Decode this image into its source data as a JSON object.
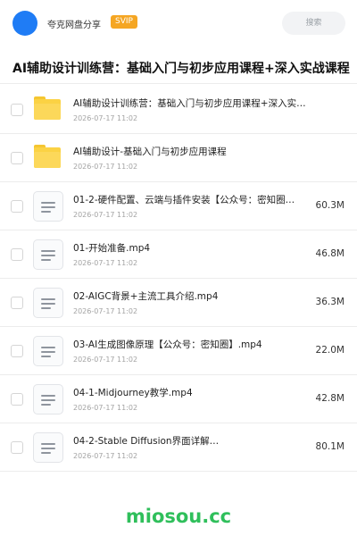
{
  "header": {
    "brand": "夸克网盘分享",
    "badge": "SVIP",
    "search_placeholder": "搜索",
    "accent_color": "#1f7cf5",
    "badge_color": "#f5a623"
  },
  "page_title": "AI辅助设计训练营：基础入门与初步应用课程+深入实战课程",
  "files": [
    {
      "type": "folder",
      "icon": "folder-icon",
      "name": "AI辅助设计训练营：基础入门与初步应用课程+深入实…",
      "date": "2026-07-17 11:02",
      "size": ""
    },
    {
      "type": "folder",
      "icon": "folder-icon",
      "name": "AI辅助设计-基础入门与初步应用课程",
      "date": "2026-07-17 11:02",
      "size": ""
    },
    {
      "type": "file",
      "icon": "document-icon",
      "name": "01-2-硬件配置、云端与插件安装【公众号：密知圈…",
      "date": "2026-07-17 11:02",
      "size": "60.3M"
    },
    {
      "type": "file",
      "icon": "document-icon",
      "name": "01-开始准备.mp4",
      "date": "2026-07-17 11:02",
      "size": "46.8M"
    },
    {
      "type": "file",
      "icon": "document-icon",
      "name": "02-AIGC背景+主流工具介绍.mp4",
      "date": "2026-07-17 11:02",
      "size": "36.3M"
    },
    {
      "type": "file",
      "icon": "document-icon",
      "name": "03-AI生成图像原理【公众号：密知圈】.mp4",
      "date": "2026-07-17 11:02",
      "size": "22.0M"
    },
    {
      "type": "file",
      "icon": "document-icon",
      "name": "04-1-Midjourney教学.mp4",
      "date": "2026-07-17 11:02",
      "size": "42.8M"
    },
    {
      "type": "file",
      "icon": "document-icon",
      "name": "04-2-Stable Diffusion界面详解…",
      "date": "2026-07-17 11:02",
      "size": "80.1M"
    }
  ],
  "watermark": "miosou.cc"
}
